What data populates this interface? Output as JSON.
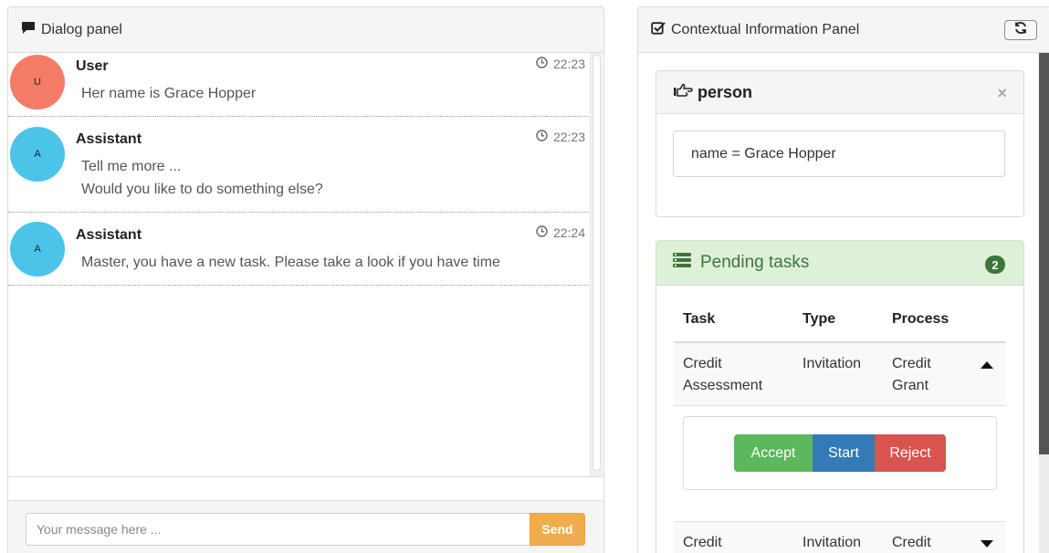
{
  "dialog": {
    "title": "Dialog panel",
    "messages": [
      {
        "avatar": "U",
        "avatar_color": "#f47c67",
        "sender": "User",
        "time": "22:23",
        "lines": [
          "Her name is Grace Hopper"
        ]
      },
      {
        "avatar": "A",
        "avatar_color": "#4cc3e9",
        "sender": "Assistant",
        "time": "22:23",
        "lines": [
          "Tell me more ...",
          "Would you like to do something else?"
        ]
      },
      {
        "avatar": "A",
        "avatar_color": "#4cc3e9",
        "sender": "Assistant",
        "time": "22:24",
        "lines": [
          "Master, you have a new task. Please take a look if you have time"
        ]
      }
    ],
    "input_placeholder": "Your message here ...",
    "send_label": "Send"
  },
  "context": {
    "title": "Contextual Information Panel",
    "person_card": {
      "title": "person",
      "close": "×",
      "entity": "name = Grace Hopper"
    },
    "tasks_card": {
      "title": "Pending tasks",
      "count": "2",
      "columns": [
        "Task",
        "Type",
        "Process"
      ],
      "rows": [
        {
          "task": [
            "Credit",
            "Assessment"
          ],
          "type": "Invitation",
          "process": [
            "Credit",
            "Grant"
          ],
          "expanded": true
        },
        {
          "task": [
            "Credit"
          ],
          "type": "Invitation",
          "process": [
            "Credit"
          ],
          "expanded": false
        }
      ],
      "actions": {
        "accept": "Accept",
        "start": "Start",
        "reject": "Reject"
      }
    }
  },
  "colors": {
    "accept": "#5cb85c",
    "start": "#337ab7",
    "reject": "#d9534f",
    "send": "#f0ad4e",
    "success_bg": "#dff0d8",
    "success_text": "#3c763d"
  }
}
